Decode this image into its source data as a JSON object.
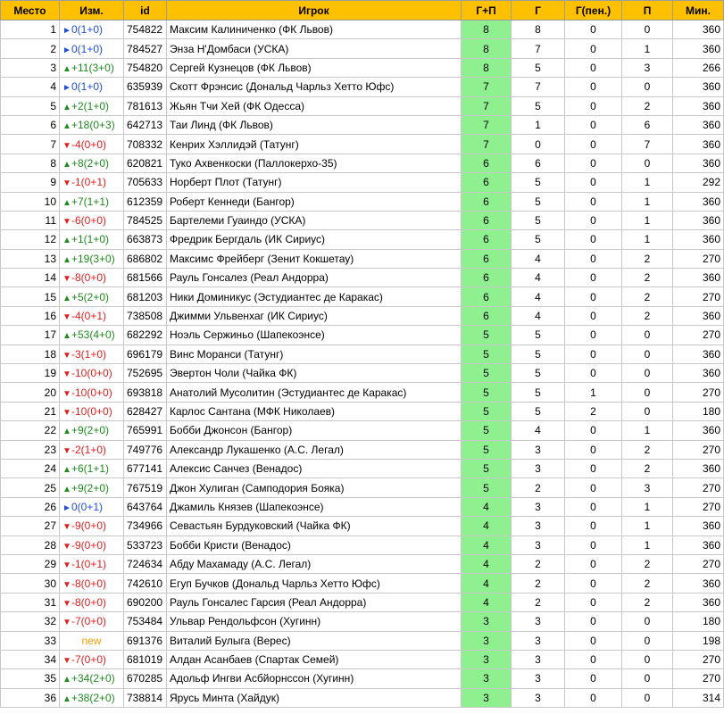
{
  "headers": [
    "Место",
    "Изм.",
    "id",
    "Игрок",
    "Г+П",
    "Г",
    "Г(пен.)",
    "П",
    "Мин."
  ],
  "rows": [
    {
      "place": "1",
      "chg": "0(1+0)",
      "dir": "same",
      "id": "754822",
      "player": "Максим Калиниченко (ФК Львов)",
      "gp": "8",
      "g": "8",
      "pen": "0",
      "a": "0",
      "min": "360"
    },
    {
      "place": "2",
      "chg": "0(1+0)",
      "dir": "same",
      "id": "784527",
      "player": "Энза Н'Домбаси (УСКА)",
      "gp": "8",
      "g": "7",
      "pen": "0",
      "a": "1",
      "min": "360"
    },
    {
      "place": "3",
      "chg": "+11(3+0)",
      "dir": "up",
      "id": "754820",
      "player": "Сергей Кузнецов (ФК Львов)",
      "gp": "8",
      "g": "5",
      "pen": "0",
      "a": "3",
      "min": "266"
    },
    {
      "place": "4",
      "chg": "0(1+0)",
      "dir": "same",
      "id": "635939",
      "player": "Скотт Фрэнсис (Дональд Чарльз Хетто Юфс)",
      "gp": "7",
      "g": "7",
      "pen": "0",
      "a": "0",
      "min": "360"
    },
    {
      "place": "5",
      "chg": "+2(1+0)",
      "dir": "up",
      "id": "781613",
      "player": "Жьян Тчи Хей (ФК Одесса)",
      "gp": "7",
      "g": "5",
      "pen": "0",
      "a": "2",
      "min": "360"
    },
    {
      "place": "6",
      "chg": "+18(0+3)",
      "dir": "up",
      "id": "642713",
      "player": "Таи Линд (ФК Львов)",
      "gp": "7",
      "g": "1",
      "pen": "0",
      "a": "6",
      "min": "360"
    },
    {
      "place": "7",
      "chg": "-4(0+0)",
      "dir": "down",
      "id": "708332",
      "player": "Кенрих Хэллидэй (Татунг)",
      "gp": "7",
      "g": "0",
      "pen": "0",
      "a": "7",
      "min": "360"
    },
    {
      "place": "8",
      "chg": "+8(2+0)",
      "dir": "up",
      "id": "620821",
      "player": "Туко Ахвенкоски (Паллокерхо-35)",
      "gp": "6",
      "g": "6",
      "pen": "0",
      "a": "0",
      "min": "360"
    },
    {
      "place": "9",
      "chg": "-1(0+1)",
      "dir": "down",
      "id": "705633",
      "player": "Норберт Плот (Татунг)",
      "gp": "6",
      "g": "5",
      "pen": "0",
      "a": "1",
      "min": "292"
    },
    {
      "place": "10",
      "chg": "+7(1+1)",
      "dir": "up",
      "id": "612359",
      "player": "Роберт Кеннеди (Бангор)",
      "gp": "6",
      "g": "5",
      "pen": "0",
      "a": "1",
      "min": "360"
    },
    {
      "place": "11",
      "chg": "-6(0+0)",
      "dir": "down",
      "id": "784525",
      "player": "Бартелеми Гуаиндо (УСКА)",
      "gp": "6",
      "g": "5",
      "pen": "0",
      "a": "1",
      "min": "360"
    },
    {
      "place": "12",
      "chg": "+1(1+0)",
      "dir": "up",
      "id": "663873",
      "player": "Фредрик Бергдаль (ИК Сириус)",
      "gp": "6",
      "g": "5",
      "pen": "0",
      "a": "1",
      "min": "360"
    },
    {
      "place": "13",
      "chg": "+19(3+0)",
      "dir": "up",
      "id": "686802",
      "player": "Максимс Фрейберг (Зенит Кокшетау)",
      "gp": "6",
      "g": "4",
      "pen": "0",
      "a": "2",
      "min": "270"
    },
    {
      "place": "14",
      "chg": "-8(0+0)",
      "dir": "down",
      "id": "681566",
      "player": "Рауль Гонсалез (Реал Андорра)",
      "gp": "6",
      "g": "4",
      "pen": "0",
      "a": "2",
      "min": "360"
    },
    {
      "place": "15",
      "chg": "+5(2+0)",
      "dir": "up",
      "id": "681203",
      "player": "Ники Доминикус (Эстудиантес де Каракас)",
      "gp": "6",
      "g": "4",
      "pen": "0",
      "a": "2",
      "min": "270"
    },
    {
      "place": "16",
      "chg": "-4(0+1)",
      "dir": "down",
      "id": "738508",
      "player": "Джимми Ульвенхаг (ИК Сириус)",
      "gp": "6",
      "g": "4",
      "pen": "0",
      "a": "2",
      "min": "360"
    },
    {
      "place": "17",
      "chg": "+53(4+0)",
      "dir": "up",
      "id": "682292",
      "player": "Ноэль Сержиньо (Шапекоэнсе)",
      "gp": "5",
      "g": "5",
      "pen": "0",
      "a": "0",
      "min": "270"
    },
    {
      "place": "18",
      "chg": "-3(1+0)",
      "dir": "down",
      "id": "696179",
      "player": "Винс Моранси (Татунг)",
      "gp": "5",
      "g": "5",
      "pen": "0",
      "a": "0",
      "min": "360"
    },
    {
      "place": "19",
      "chg": "-10(0+0)",
      "dir": "down",
      "id": "752695",
      "player": "Эвертон Чоли (Чайка ФК)",
      "gp": "5",
      "g": "5",
      "pen": "0",
      "a": "0",
      "min": "360"
    },
    {
      "place": "20",
      "chg": "-10(0+0)",
      "dir": "down",
      "id": "693818",
      "player": "Анатолий Мусолитин (Эстудиантес де Каракас)",
      "gp": "5",
      "g": "5",
      "pen": "1",
      "a": "0",
      "min": "270"
    },
    {
      "place": "21",
      "chg": "-10(0+0)",
      "dir": "down",
      "id": "628427",
      "player": "Карлос Сантана (МФК Николаев)",
      "gp": "5",
      "g": "5",
      "pen": "2",
      "a": "0",
      "min": "180"
    },
    {
      "place": "22",
      "chg": "+9(2+0)",
      "dir": "up",
      "id": "765991",
      "player": "Бобби Джонсон (Бангор)",
      "gp": "5",
      "g": "4",
      "pen": "0",
      "a": "1",
      "min": "360"
    },
    {
      "place": "23",
      "chg": "-2(1+0)",
      "dir": "down",
      "id": "749776",
      "player": "Александр Лукашенко (А.С. Легал)",
      "gp": "5",
      "g": "3",
      "pen": "0",
      "a": "2",
      "min": "270"
    },
    {
      "place": "24",
      "chg": "+6(1+1)",
      "dir": "up",
      "id": "677141",
      "player": "Алексис Санчез (Венадос)",
      "gp": "5",
      "g": "3",
      "pen": "0",
      "a": "2",
      "min": "360"
    },
    {
      "place": "25",
      "chg": "+9(2+0)",
      "dir": "up",
      "id": "767519",
      "player": "Джон Хулиган (Самподория Бояка)",
      "gp": "5",
      "g": "2",
      "pen": "0",
      "a": "3",
      "min": "270"
    },
    {
      "place": "26",
      "chg": "0(0+1)",
      "dir": "same",
      "id": "643764",
      "player": "Джамиль Князев (Шапекоэнсе)",
      "gp": "4",
      "g": "3",
      "pen": "0",
      "a": "1",
      "min": "270"
    },
    {
      "place": "27",
      "chg": "-9(0+0)",
      "dir": "down",
      "id": "734966",
      "player": "Севастьян Бурдуковский (Чайка ФК)",
      "gp": "4",
      "g": "3",
      "pen": "0",
      "a": "1",
      "min": "360"
    },
    {
      "place": "28",
      "chg": "-9(0+0)",
      "dir": "down",
      "id": "533723",
      "player": "Бобби Кристи (Венадос)",
      "gp": "4",
      "g": "3",
      "pen": "0",
      "a": "1",
      "min": "360"
    },
    {
      "place": "29",
      "chg": "-1(0+1)",
      "dir": "down",
      "id": "724634",
      "player": "Абду Махамаду (А.С. Легал)",
      "gp": "4",
      "g": "2",
      "pen": "0",
      "a": "2",
      "min": "270"
    },
    {
      "place": "30",
      "chg": "-8(0+0)",
      "dir": "down",
      "id": "742610",
      "player": "Егуп Бучков (Дональд Чарльз Хетто Юфс)",
      "gp": "4",
      "g": "2",
      "pen": "0",
      "a": "2",
      "min": "360"
    },
    {
      "place": "31",
      "chg": "-8(0+0)",
      "dir": "down",
      "id": "690200",
      "player": "Рауль Гонсалес Гарсия (Реал Андорра)",
      "gp": "4",
      "g": "2",
      "pen": "0",
      "a": "2",
      "min": "360"
    },
    {
      "place": "32",
      "chg": "-7(0+0)",
      "dir": "down",
      "id": "753484",
      "player": "Ульвар Рендольфсон (Хугинн)",
      "gp": "3",
      "g": "3",
      "pen": "0",
      "a": "0",
      "min": "180"
    },
    {
      "place": "33",
      "chg": "new",
      "dir": "new",
      "id": "691376",
      "player": "Виталий Булыга (Верес)",
      "gp": "3",
      "g": "3",
      "pen": "0",
      "a": "0",
      "min": "198"
    },
    {
      "place": "34",
      "chg": "-7(0+0)",
      "dir": "down",
      "id": "681019",
      "player": "Алдан Асанбаев (Спартак Семей)",
      "gp": "3",
      "g": "3",
      "pen": "0",
      "a": "0",
      "min": "270"
    },
    {
      "place": "35",
      "chg": "+34(2+0)",
      "dir": "up",
      "id": "670285",
      "player": "Адольф Ингви Асбйорнссон (Хугинн)",
      "gp": "3",
      "g": "3",
      "pen": "0",
      "a": "0",
      "min": "270"
    },
    {
      "place": "36",
      "chg": "+38(2+0)",
      "dir": "up",
      "id": "738814",
      "player": "Ярусь Минта (Хайдук)",
      "gp": "3",
      "g": "3",
      "pen": "0",
      "a": "0",
      "min": "314"
    }
  ],
  "arrows": {
    "up": "▲",
    "down": "▼",
    "same": "►"
  },
  "colors": {
    "header": "#ffc000",
    "gp_cell": "#8ff08f",
    "up": "#1f8b1f",
    "down": "#e02020",
    "same": "#1f4fd8",
    "new": "#f0a000"
  }
}
